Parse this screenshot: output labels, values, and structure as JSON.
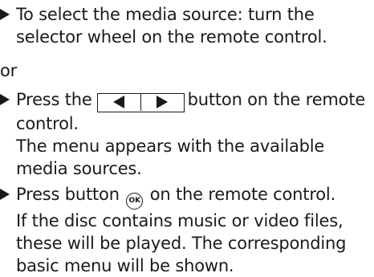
{
  "steps": [
    {
      "text": "To select the media source: turn the selector wheel on the remote control."
    },
    {
      "text_before": "Press the",
      "text_after": "button on the remote control.",
      "result": "The menu appears with the available media sources."
    },
    {
      "text_before": "Press button",
      "ok_label": "OK",
      "text_after": "on the remote control.",
      "result": "If the disc contains music or video files, these will be played. The corresponding basic menu will be shown."
    }
  ],
  "or_label": "or",
  "icons": {
    "bullet": "triangle-right-bullet-icon",
    "prev": "arrow-left-icon",
    "next": "arrow-right-icon",
    "ok": "ok-button-icon"
  }
}
